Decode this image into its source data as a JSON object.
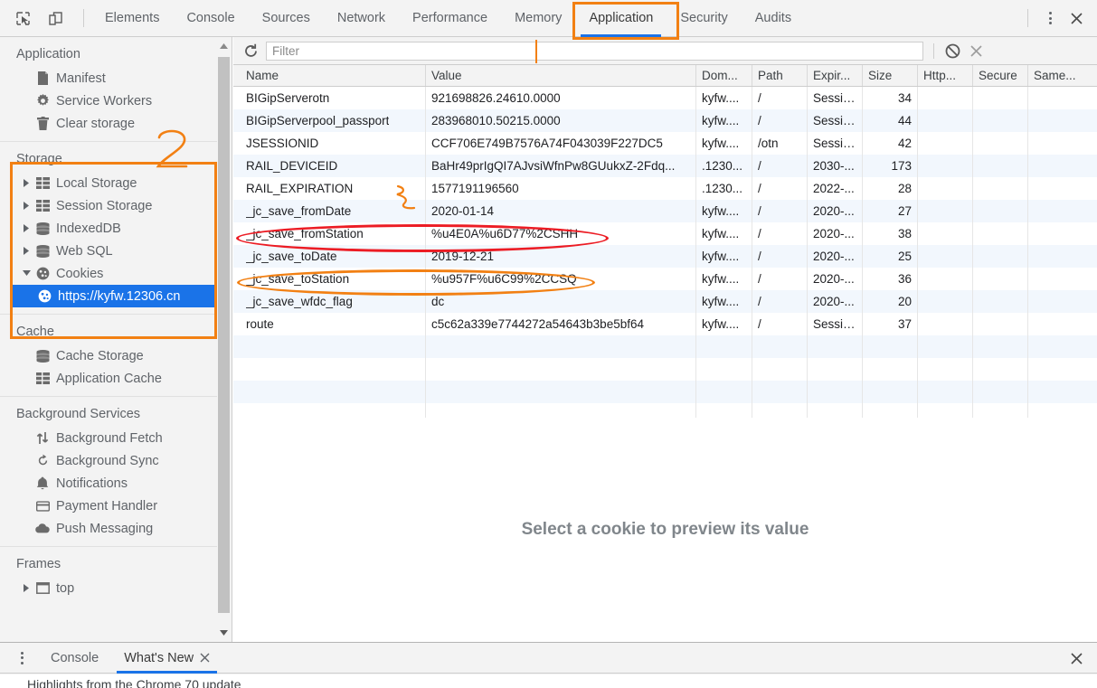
{
  "toolbar": {
    "icons": [
      {
        "name": "inspect-element-icon",
        "glyph": "inspect"
      },
      {
        "name": "device-toolbar-icon",
        "glyph": "device"
      }
    ],
    "tabs": [
      {
        "label": "Elements",
        "active": false
      },
      {
        "label": "Console",
        "active": false
      },
      {
        "label": "Sources",
        "active": false
      },
      {
        "label": "Network",
        "active": false
      },
      {
        "label": "Performance",
        "active": false
      },
      {
        "label": "Memory",
        "active": false
      },
      {
        "label": "Application",
        "active": true
      },
      {
        "label": "Security",
        "active": false
      },
      {
        "label": "Audits",
        "active": false
      }
    ],
    "active_tab": "Application",
    "more_label": "more-options",
    "close_label": "close-devtools"
  },
  "sidebar": {
    "groups": [
      {
        "title": "Application",
        "items": [
          {
            "label": "Manifest",
            "icon": "document-icon",
            "twisty": "",
            "selected": false
          },
          {
            "label": "Service Workers",
            "icon": "gear-icon",
            "twisty": "",
            "selected": false
          },
          {
            "label": "Clear storage",
            "icon": "trash-icon",
            "twisty": "",
            "selected": false
          }
        ]
      },
      {
        "title": "Storage",
        "items": [
          {
            "label": "Local Storage",
            "icon": "table-icon",
            "twisty": "collapsed",
            "selected": false
          },
          {
            "label": "Session Storage",
            "icon": "table-icon",
            "twisty": "collapsed",
            "selected": false
          },
          {
            "label": "IndexedDB",
            "icon": "database-icon",
            "twisty": "collapsed",
            "selected": false
          },
          {
            "label": "Web SQL",
            "icon": "database-icon",
            "twisty": "collapsed",
            "selected": false
          },
          {
            "label": "Cookies",
            "icon": "cookie-icon",
            "twisty": "expanded",
            "selected": false
          },
          {
            "label": "https://kyfw.12306.cn",
            "icon": "cookie-icon",
            "twisty": "",
            "selected": true
          }
        ]
      },
      {
        "title": "Cache",
        "items": [
          {
            "label": "Cache Storage",
            "icon": "database-icon",
            "twisty": "",
            "selected": false
          },
          {
            "label": "Application Cache",
            "icon": "table-icon",
            "twisty": "",
            "selected": false
          }
        ]
      },
      {
        "title": "Background Services",
        "items": [
          {
            "label": "Background Fetch",
            "icon": "updown-arrows-icon",
            "twisty": "",
            "selected": false
          },
          {
            "label": "Background Sync",
            "icon": "sync-icon",
            "twisty": "",
            "selected": false
          },
          {
            "label": "Notifications",
            "icon": "bell-icon",
            "twisty": "",
            "selected": false
          },
          {
            "label": "Payment Handler",
            "icon": "card-icon",
            "twisty": "",
            "selected": false
          },
          {
            "label": "Push Messaging",
            "icon": "cloud-icon",
            "twisty": "",
            "selected": false
          }
        ]
      },
      {
        "title": "Frames",
        "items": [
          {
            "label": "top",
            "icon": "frame-icon",
            "twisty": "collapsed",
            "selected": false
          }
        ]
      }
    ]
  },
  "filterbar": {
    "reload_label": "refresh-cookies",
    "filter_placeholder": "Filter",
    "filter_value": "",
    "clear_label": "clear-all-cookies",
    "delete_label": "delete-selected-cookie"
  },
  "table": {
    "columns": [
      "Name",
      "Value",
      "Dom...",
      "Path",
      "Expir...",
      "Size",
      "Http...",
      "Secure",
      "Same..."
    ],
    "rows": [
      {
        "name": "BIGipServerotn",
        "value": "921698826.24610.0000",
        "domain": "kyfw....",
        "path": "/",
        "expires": "Session",
        "size": "34",
        "http": "",
        "secure": "",
        "samesite": ""
      },
      {
        "name": "BIGipServerpool_passport",
        "value": "283968010.50215.0000",
        "domain": "kyfw....",
        "path": "/",
        "expires": "Session",
        "size": "44",
        "http": "",
        "secure": "",
        "samesite": ""
      },
      {
        "name": "JSESSIONID",
        "value": "CCF706E749B7576A74F043039F227DC5",
        "domain": "kyfw....",
        "path": "/otn",
        "expires": "Session",
        "size": "42",
        "http": "",
        "secure": "",
        "samesite": ""
      },
      {
        "name": "RAIL_DEVICEID",
        "value": "BaHr49prIgQI7AJvsiWfnPw8GUukxZ-2Fdq...",
        "domain": ".1230...",
        "path": "/",
        "expires": "2030-...",
        "size": "173",
        "http": "",
        "secure": "",
        "samesite": ""
      },
      {
        "name": "RAIL_EXPIRATION",
        "value": "1577191196560",
        "domain": ".1230...",
        "path": "/",
        "expires": "2022-...",
        "size": "28",
        "http": "",
        "secure": "",
        "samesite": ""
      },
      {
        "name": "_jc_save_fromDate",
        "value": "2020-01-14",
        "domain": "kyfw....",
        "path": "/",
        "expires": "2020-...",
        "size": "27",
        "http": "",
        "secure": "",
        "samesite": ""
      },
      {
        "name": "_jc_save_fromStation",
        "value": "%u4E0A%u6D77%2CSHH",
        "domain": "kyfw....",
        "path": "/",
        "expires": "2020-...",
        "size": "38",
        "http": "",
        "secure": "",
        "samesite": ""
      },
      {
        "name": "_jc_save_toDate",
        "value": "2019-12-21",
        "domain": "kyfw....",
        "path": "/",
        "expires": "2020-...",
        "size": "25",
        "http": "",
        "secure": "",
        "samesite": ""
      },
      {
        "name": "_jc_save_toStation",
        "value": "%u957F%u6C99%2CCSQ",
        "domain": "kyfw....",
        "path": "/",
        "expires": "2020-...",
        "size": "36",
        "http": "",
        "secure": "",
        "samesite": ""
      },
      {
        "name": "_jc_save_wfdc_flag",
        "value": "dc",
        "domain": "kyfw....",
        "path": "/",
        "expires": "2020-...",
        "size": "20",
        "http": "",
        "secure": "",
        "samesite": ""
      },
      {
        "name": "route",
        "value": "c5c62a339e7744272a54643b3be5bf64",
        "domain": "kyfw....",
        "path": "/",
        "expires": "Session",
        "size": "37",
        "http": "",
        "secure": "",
        "samesite": ""
      }
    ]
  },
  "preview": {
    "message": "Select a cookie to preview its value"
  },
  "drawer": {
    "menu_label": "drawer-more-options",
    "tabs": [
      {
        "label": "Console",
        "active": false,
        "closable": false
      },
      {
        "label": "What's New",
        "active": true,
        "closable": true
      }
    ],
    "close_label": "close-drawer",
    "body_text": "Highlights from the Chrome 70 update"
  },
  "annotations": {
    "colors": {
      "orange": "#f28013",
      "red": "#ec1c24",
      "accent_blue": "#1a73e8",
      "selection_blue": "#1a73e8"
    },
    "marks": [
      {
        "name": "application-tab-highlight",
        "shape": "rect",
        "color": "#f28013"
      },
      {
        "name": "storage-section-highlight",
        "shape": "rect",
        "color": "#f28013"
      },
      {
        "name": "step-number-2",
        "shape": "digit",
        "text": "2",
        "color": "#f28013"
      },
      {
        "name": "from-station-row-highlight",
        "shape": "ellipse",
        "color": "#ec1c24"
      },
      {
        "name": "to-station-row-highlight",
        "shape": "ellipse",
        "color": "#f28013"
      },
      {
        "name": "squiggle-mark",
        "shape": "squiggle",
        "color": "#f28013"
      }
    ],
    "step_number": "2"
  }
}
